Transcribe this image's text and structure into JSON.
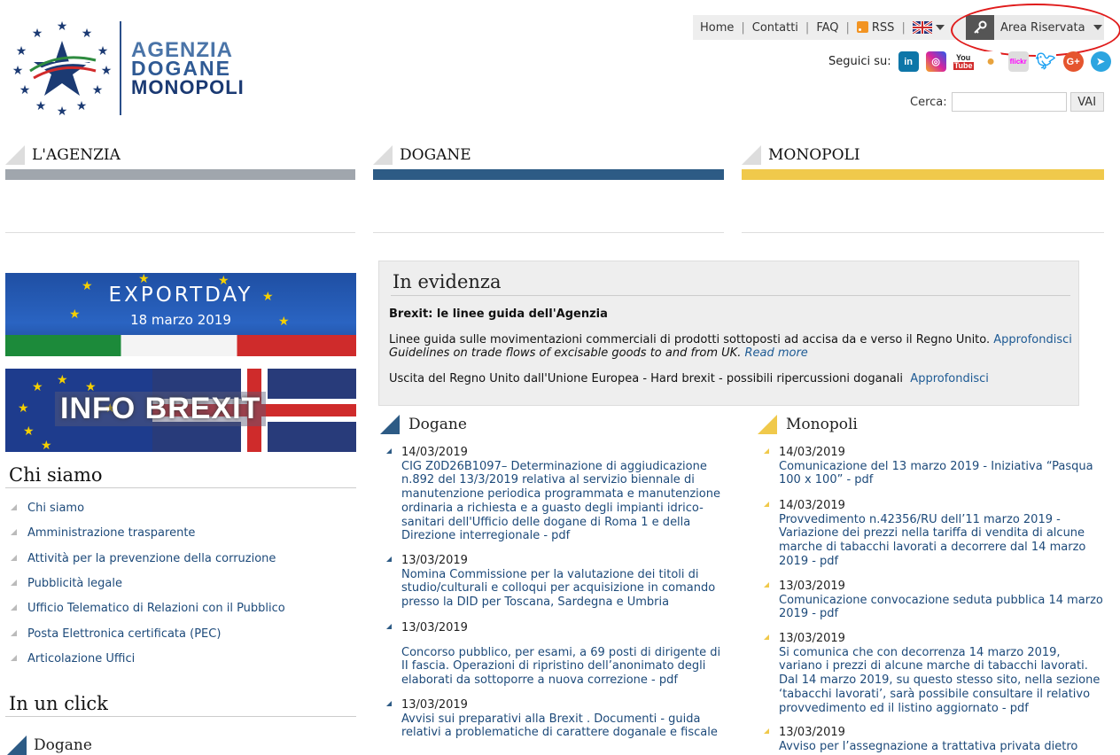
{
  "logo": {
    "line1": "AGENZIA",
    "line2": "DOGANE",
    "line3": "MONOPOLI"
  },
  "topnav": {
    "home": "Home",
    "contatti": "Contatti",
    "faq": "FAQ",
    "rss": "RSS",
    "area": "Area Riservata"
  },
  "social": {
    "label": "Seguici su:",
    "icons": [
      "linkedin-icon",
      "instagram-icon",
      "youtube-icon",
      "slideshare-icon",
      "flickr-icon",
      "twitter-icon",
      "googleplus-icon",
      "telegram-icon"
    ]
  },
  "search": {
    "label": "Cerca:",
    "button": "VAI",
    "value": ""
  },
  "sections": [
    {
      "title": "L'AGENZIA",
      "color": "#a0a6ad"
    },
    {
      "title": "DOGANE",
      "color": "#2d5b85"
    },
    {
      "title": "MONOPOLI",
      "color": "#f0c94b"
    }
  ],
  "banners": {
    "export_title": "EXPORTDAY",
    "export_date": "18 marzo 2019",
    "brexit": "INFO BREXIT"
  },
  "chi_siamo": {
    "title": "Chi siamo",
    "items": [
      "Chi siamo",
      "Amministrazione trasparente",
      "Attività per la prevenzione della corruzione",
      "Pubblicità legale",
      "Ufficio Telematico di Relazioni con il Pubblico",
      "Posta Elettronica certificata (PEC)",
      "Articolazione Uffici"
    ]
  },
  "in_un_click": {
    "title": "In un click",
    "sub": "Dogane"
  },
  "evidenza": {
    "title": "In evidenza",
    "headline": "Brexit: le linee guida dell'Agenzia",
    "p1": "Linee guida sulle movimentazioni commerciali di prodotti sottoposti ad accisa da e verso il Regno Unito.",
    "p1_link": "Approfondisci",
    "p2": "Guidelines on trade flows of excisable goods to and from UK.",
    "p2_link": "Read more",
    "p3": "Uscita del Regno Unito dall'Unione Europea - Hard brexit - possibili ripercussioni doganali",
    "p3_link": "Approfondisci"
  },
  "dogane": {
    "title": "Dogane",
    "news": [
      {
        "date": "14/03/2019",
        "text": "CIG Z0D26B1097– Determinazione di aggiudicazione n.892 del 13/3/2019 relativa al servizio biennale di manutenzione periodica programmata e manutenzione ordinaria a richiesta e a guasto degli impianti idrico-sanitari dell'Ufficio delle dogane di Roma 1 e della Direzione interregionale - pdf"
      },
      {
        "date": "13/03/2019",
        "text": "Nomina Commissione per la valutazione dei titoli di studio/culturali e colloqui per acquisizione in comando presso la DID per Toscana, Sardegna e Umbria"
      },
      {
        "date": "13/03/2019",
        "text": "Concorso pubblico, per esami, a 69 posti di dirigente di II fascia. Operazioni di ripristino dell’anonimato degli elaborati da sottoporre a nuova correzione - pdf"
      },
      {
        "date": "13/03/2019",
        "text": "Avvisi sui preparativi alla Brexit . Documenti - guida relativi a problematiche di carattere doganale e fiscale"
      }
    ]
  },
  "monopoli": {
    "title": "Monopoli",
    "news": [
      {
        "date": "14/03/2019",
        "text": "Comunicazione del 13 marzo 2019 - Iniziativa “Pasqua 100 x 100” - pdf"
      },
      {
        "date": "14/03/2019",
        "text": "Provvedimento n.42356/RU dell’11 marzo 2019 - Variazione dei prezzi nella tariffa di vendita di alcune marche di tabacchi lavorati a decorrere dal 14 marzo 2019 - pdf"
      },
      {
        "date": "13/03/2019",
        "text": "Comunicazione convocazione seduta pubblica 14 marzo 2019 - pdf"
      },
      {
        "date": "13/03/2019",
        "text": "Si comunica che con decorrenza 14 marzo 2019, variano i prezzi di alcune marche di tabacchi lavorati. Dal 14 marzo 2019, su questo stesso sito, nella sezione ‘tabacchi lavorati’, sarà possibile consultare il relativo provvedimento ed il listino aggiornato - pdf"
      },
      {
        "date": "13/03/2019",
        "text": "Avviso per l’assegnazione a trattativa privata dietro"
      }
    ]
  }
}
